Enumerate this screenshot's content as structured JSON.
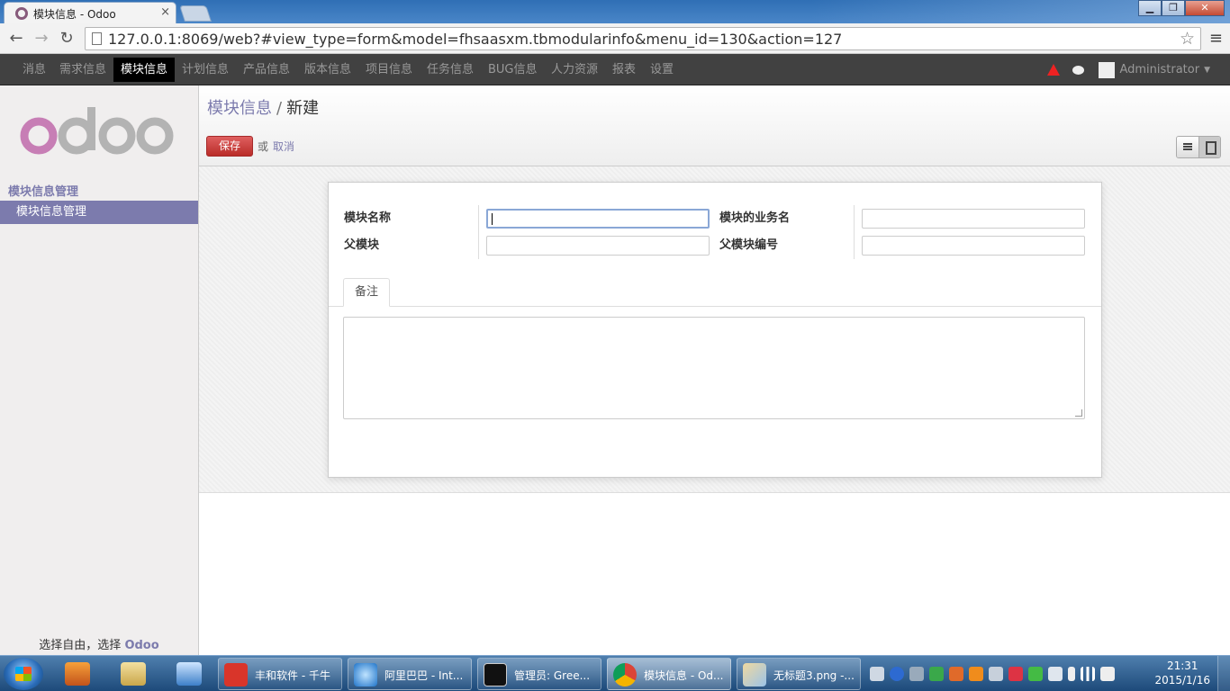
{
  "browser": {
    "tab_title": "模块信息 - Odoo",
    "tab_close": "×",
    "url": "127.0.0.1:8069/web?#view_type=form&model=fhsaasxm.tbmodularinfo&menu_id=130&action=127",
    "window_buttons": {
      "minimize": "▁",
      "maximize": "❐",
      "close": "✕"
    }
  },
  "topmenu": {
    "items": [
      {
        "label": "消息"
      },
      {
        "label": "需求信息"
      },
      {
        "label": "模块信息"
      },
      {
        "label": "计划信息"
      },
      {
        "label": "产品信息"
      },
      {
        "label": "版本信息"
      },
      {
        "label": "项目信息"
      },
      {
        "label": "任务信息"
      },
      {
        "label": "BUG信息"
      },
      {
        "label": "人力资源"
      },
      {
        "label": "报表"
      },
      {
        "label": "设置"
      }
    ],
    "active_index": 2,
    "user": "Administrator"
  },
  "sidebar": {
    "section_title": "模块信息管理",
    "items": [
      {
        "label": "模块信息管理"
      }
    ],
    "footer_prefix": "选择自由，选择",
    "footer_brand": "Odoo"
  },
  "control_panel": {
    "breadcrumb_parent": "模块信息",
    "breadcrumb_separator": "/",
    "breadcrumb_current": "新建",
    "save_label": "保存",
    "or_label": "或",
    "discard_label": "取消"
  },
  "form": {
    "fields": [
      {
        "label": "模块名称",
        "value": ""
      },
      {
        "label": "父模块",
        "value": ""
      },
      {
        "label": "模块的业务名",
        "value": ""
      },
      {
        "label": "父模块编号",
        "value": ""
      }
    ],
    "notebook_tab": "备注",
    "notes_value": ""
  },
  "taskbar": {
    "tasks": [
      {
        "label": "丰和软件 - 千牛"
      },
      {
        "label": "阿里巴巴 - Int..."
      },
      {
        "label": "管理员: Gree..."
      },
      {
        "label": "模块信息 - Od..."
      },
      {
        "label": "无标题3.png -..."
      }
    ],
    "time": "21:31",
    "date": "2015/1/16"
  },
  "colors": {
    "odoo_purple": "#7c7bad",
    "logo_purple": "#c77eb5",
    "logo_grey": "#b3b3b3",
    "save_red": "#dc5a5a",
    "menu_bg": "#414141"
  }
}
